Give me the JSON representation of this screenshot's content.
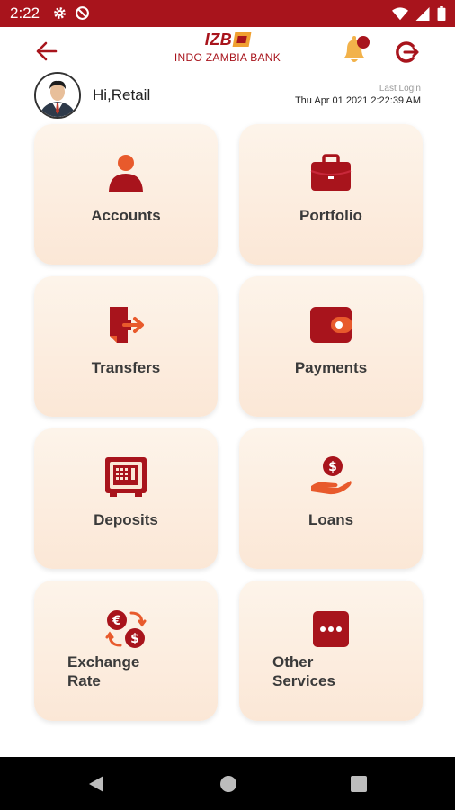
{
  "status_bar": {
    "time": "2:22",
    "icons": [
      "gear-icon",
      "data-saver-icon",
      "wifi-icon",
      "signal-icon",
      "battery-icon"
    ]
  },
  "header": {
    "brand_short": "IZB",
    "brand_name": "INDO ZAMBIA BANK",
    "icons": [
      "back-arrow-icon",
      "notification-bell-icon",
      "logout-icon"
    ]
  },
  "user": {
    "greeting": "Hi,Retail",
    "last_login_label": "Last Login",
    "last_login_value": "Thu Apr 01 2021  2:22:39 AM"
  },
  "tiles": [
    {
      "label": "Accounts",
      "icon": "user-icon"
    },
    {
      "label": "Portfolio",
      "icon": "briefcase-icon"
    },
    {
      "label": "Transfers",
      "icon": "transfer-icon"
    },
    {
      "label": "Payments",
      "icon": "wallet-icon"
    },
    {
      "label": "Deposits",
      "icon": "safe-icon"
    },
    {
      "label": "Loans",
      "icon": "loan-hand-coin-icon"
    },
    {
      "label_line1": "Exchange",
      "label_line2": "Rate",
      "icon": "currency-exchange-icon"
    },
    {
      "label_line1": "Other",
      "label_line2": "Services",
      "icon": "more-dots-icon"
    }
  ],
  "colors": {
    "brand": "#a8141c",
    "accent": "#e85a2c",
    "bell": "#f2b24a",
    "tile_top": "#fdf4ea",
    "tile_bottom": "#fbe7d6"
  },
  "nav_bar": {
    "icons": [
      "nav-back-icon",
      "nav-home-icon",
      "nav-recents-icon"
    ]
  }
}
